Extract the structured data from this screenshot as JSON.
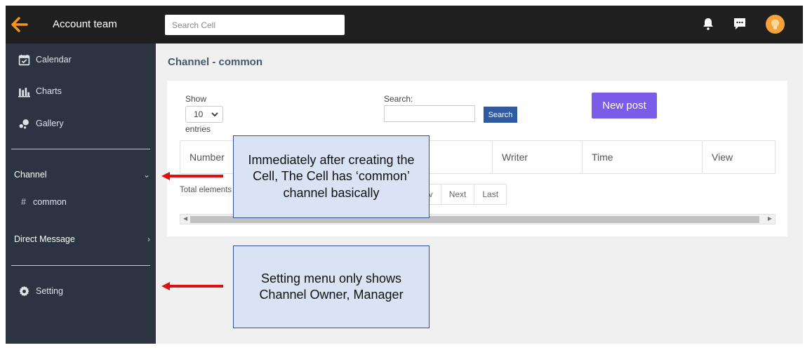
{
  "sidebar": {
    "title": "Account team",
    "nav": [
      {
        "label": "Calendar",
        "icon": "calendar-icon"
      },
      {
        "label": "Charts",
        "icon": "bar-chart-icon"
      },
      {
        "label": "Gallery",
        "icon": "gallery-icon"
      }
    ],
    "channel_section": "Channel",
    "channels": [
      {
        "label": "common",
        "prefix": "#"
      }
    ],
    "dm_section": "Direct Message",
    "setting": "Setting"
  },
  "topbar": {
    "search_placeholder": "Search Cell",
    "icons": [
      "bell-icon",
      "chat-icon",
      "avatar"
    ]
  },
  "main": {
    "page_title": "Channel - common",
    "show_label": "Show",
    "entries_select_value": "10",
    "entries_label": "entries",
    "search_label": "Search:",
    "search_button": "Search",
    "new_post_button": "New post",
    "table_headers": [
      "Number",
      "Writer",
      "Time",
      "View"
    ],
    "total_label": "Total elements",
    "pagination": [
      "ev",
      "Next",
      "Last"
    ]
  },
  "annotations": [
    {
      "text": "Immediately after creating the Cell, The Cell has ‘common’ channel basically"
    },
    {
      "text": "Setting menu only shows Channel Owner, Manager"
    }
  ],
  "colors": {
    "accent_orange": "#f7941d",
    "sidebar_bg": "#2b3440",
    "topbar_bg": "#1f1f1f",
    "new_post": "#7b5ce8",
    "search_button": "#2f5aa0",
    "callout_fill": "#dae3f3",
    "callout_border": "#2f528f",
    "arrow_red": "#e01010"
  }
}
